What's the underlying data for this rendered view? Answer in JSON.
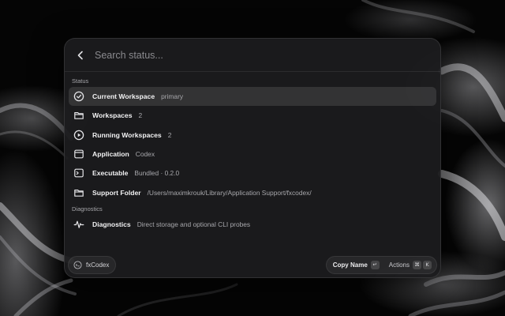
{
  "search": {
    "placeholder": "Search status..."
  },
  "sections": [
    {
      "label": "Status",
      "items": [
        {
          "icon": "check-circle-icon",
          "title": "Current Workspace",
          "subtitle": "primary",
          "selected": true
        },
        {
          "icon": "folder-icon",
          "title": "Workspaces",
          "subtitle": "2"
        },
        {
          "icon": "play-circle-icon",
          "title": "Running Workspaces",
          "subtitle": "2"
        },
        {
          "icon": "window-icon",
          "title": "Application",
          "subtitle": "Codex"
        },
        {
          "icon": "terminal-icon",
          "title": "Executable",
          "subtitle": "Bundled · 0.2.0"
        },
        {
          "icon": "folder-icon",
          "title": "Support Folder",
          "subtitle": "/Users/maximkrouk/Library/Application Support/fxcodex/"
        }
      ]
    },
    {
      "label": "Diagnostics",
      "items": [
        {
          "icon": "waveform-icon",
          "title": "Diagnostics",
          "subtitle": "Direct storage and optional CLI probes"
        }
      ]
    }
  ],
  "footer": {
    "app_name": "fxCodex",
    "primary_action": "Copy Name",
    "primary_key": "↵",
    "actions_label": "Actions",
    "actions_keys": [
      "⌘",
      "K"
    ]
  }
}
